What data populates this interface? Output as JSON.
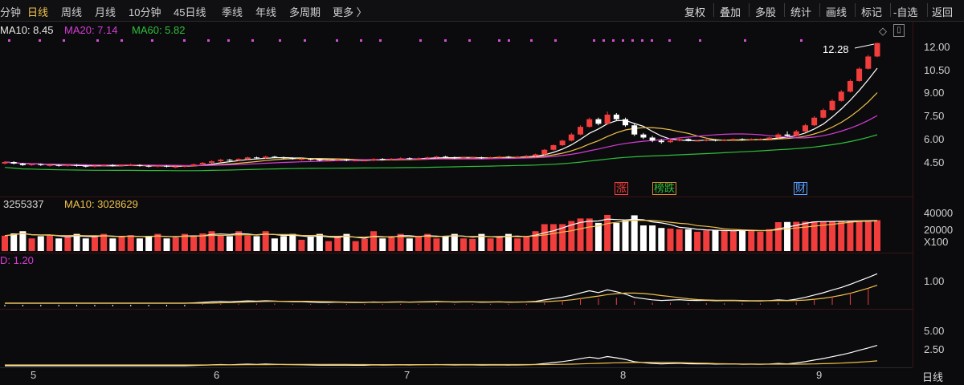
{
  "toolbar": {
    "periods": [
      "分钟",
      "日线",
      "周线",
      "月线",
      "10分钟",
      "45日线",
      "季线",
      "年线",
      "多周期",
      "更多 〉"
    ],
    "active_period": "日线",
    "tools": [
      "复权",
      "叠加",
      "多股",
      "统计",
      "画线",
      "标记",
      "-自选",
      "返回"
    ]
  },
  "ma_legend": {
    "ma10": "MA10: 8.45",
    "ma20": "MA20: 7.14",
    "ma60": "MA60: 5.82",
    "ma10_color": "#e8e8e8",
    "ma20_color": "#d63cd6",
    "ma60_color": "#2fbf3a"
  },
  "price_axis": [
    "12.00",
    "10.50",
    "9.00",
    "7.50",
    "6.00",
    "4.50"
  ],
  "last_price_label": "12.28",
  "event_tags": {
    "zhang": "涨",
    "bangdie": "榜跌",
    "cai": "财"
  },
  "volume_legend": {
    "vol": "3255337",
    "ma10": "MA10: 3028629"
  },
  "volume_axis": [
    "40000",
    "20000",
    "X100"
  ],
  "indicator_legend": "D: 1.20",
  "indicator_axis": [
    "1.00"
  ],
  "bottom_axis": [
    "5.00",
    "2.50"
  ],
  "x_axis": [
    "5",
    "6",
    "7",
    "8",
    "9"
  ],
  "corner_label": "日线",
  "colors": {
    "up": "#f23d3d",
    "down": "#ffffff",
    "accent": "#f0c14b"
  },
  "chart_data": {
    "type": "candlestick",
    "months": [
      "5",
      "6",
      "7",
      "8",
      "9"
    ],
    "price_axis": [
      4.5,
      6.0,
      7.5,
      9.0,
      10.5,
      12.0
    ],
    "last_price": 12.28,
    "candles": [
      [
        4.4,
        4.5,
        4.35,
        4.55
      ],
      [
        4.5,
        4.4,
        4.35,
        4.55
      ],
      [
        4.4,
        4.3,
        4.25,
        4.45
      ],
      [
        4.3,
        4.35,
        4.25,
        4.4
      ],
      [
        4.35,
        4.3,
        4.25,
        4.4
      ],
      [
        4.3,
        4.3,
        4.2,
        4.35
      ],
      [
        4.3,
        4.25,
        4.2,
        4.35
      ],
      [
        4.25,
        4.3,
        4.2,
        4.35
      ],
      [
        4.3,
        4.25,
        4.2,
        4.35
      ],
      [
        4.25,
        4.2,
        4.15,
        4.3
      ],
      [
        4.2,
        4.25,
        4.15,
        4.3
      ],
      [
        4.25,
        4.3,
        4.2,
        4.35
      ],
      [
        4.3,
        4.25,
        4.2,
        4.35
      ],
      [
        4.25,
        4.3,
        4.2,
        4.35
      ],
      [
        4.3,
        4.3,
        4.25,
        4.4
      ],
      [
        4.3,
        4.25,
        4.2,
        4.35
      ],
      [
        4.25,
        4.2,
        4.15,
        4.3
      ],
      [
        4.2,
        4.25,
        4.15,
        4.3
      ],
      [
        4.25,
        4.2,
        4.15,
        4.3
      ],
      [
        4.2,
        4.2,
        4.1,
        4.25
      ],
      [
        4.2,
        4.25,
        4.15,
        4.3
      ],
      [
        4.25,
        4.35,
        4.2,
        4.4
      ],
      [
        4.35,
        4.45,
        4.3,
        4.5
      ],
      [
        4.45,
        4.55,
        4.4,
        4.6
      ],
      [
        4.55,
        4.65,
        4.5,
        4.7
      ],
      [
        4.65,
        4.6,
        4.55,
        4.7
      ],
      [
        4.6,
        4.7,
        4.55,
        4.75
      ],
      [
        4.7,
        4.8,
        4.65,
        4.85
      ],
      [
        4.8,
        4.75,
        4.7,
        4.85
      ],
      [
        4.75,
        4.85,
        4.7,
        4.9
      ],
      [
        4.85,
        4.8,
        4.75,
        4.9
      ],
      [
        4.8,
        4.75,
        4.7,
        4.85
      ],
      [
        4.75,
        4.7,
        4.65,
        4.8
      ],
      [
        4.7,
        4.7,
        4.6,
        4.75
      ],
      [
        4.7,
        4.65,
        4.6,
        4.75
      ],
      [
        4.65,
        4.6,
        4.55,
        4.7
      ],
      [
        4.6,
        4.6,
        4.55,
        4.65
      ],
      [
        4.6,
        4.65,
        4.55,
        4.7
      ],
      [
        4.65,
        4.6,
        4.55,
        4.7
      ],
      [
        4.6,
        4.6,
        4.55,
        4.65
      ],
      [
        4.6,
        4.6,
        4.55,
        4.65
      ],
      [
        4.6,
        4.7,
        4.55,
        4.75
      ],
      [
        4.7,
        4.65,
        4.6,
        4.75
      ],
      [
        4.65,
        4.7,
        4.6,
        4.75
      ],
      [
        4.7,
        4.75,
        4.65,
        4.8
      ],
      [
        4.75,
        4.7,
        4.65,
        4.8
      ],
      [
        4.7,
        4.75,
        4.65,
        4.8
      ],
      [
        4.75,
        4.8,
        4.7,
        4.85
      ],
      [
        4.8,
        4.85,
        4.75,
        4.9
      ],
      [
        4.85,
        4.8,
        4.75,
        4.9
      ],
      [
        4.8,
        4.75,
        4.7,
        4.85
      ],
      [
        4.75,
        4.8,
        4.7,
        4.85
      ],
      [
        4.8,
        4.8,
        4.75,
        4.85
      ],
      [
        4.8,
        4.75,
        4.7,
        4.85
      ],
      [
        4.75,
        4.8,
        4.7,
        4.85
      ],
      [
        4.8,
        4.85,
        4.75,
        4.9
      ],
      [
        4.85,
        4.8,
        4.75,
        4.9
      ],
      [
        4.8,
        4.85,
        4.75,
        4.9
      ],
      [
        4.85,
        4.9,
        4.8,
        4.95
      ],
      [
        4.9,
        5.0,
        4.85,
        5.05
      ],
      [
        5.0,
        5.3,
        4.95,
        5.35
      ],
      [
        5.3,
        5.6,
        5.25,
        5.65
      ],
      [
        5.6,
        5.9,
        5.55,
        5.95
      ],
      [
        5.9,
        6.3,
        5.85,
        6.4
      ],
      [
        6.3,
        6.8,
        6.25,
        6.9
      ],
      [
        6.8,
        7.3,
        6.75,
        7.4
      ],
      [
        7.3,
        7.0,
        6.9,
        7.4
      ],
      [
        7.0,
        7.6,
        6.95,
        7.8
      ],
      [
        7.6,
        7.3,
        7.2,
        7.7
      ],
      [
        7.3,
        6.9,
        6.8,
        7.4
      ],
      [
        6.9,
        6.3,
        6.2,
        7.0
      ],
      [
        6.3,
        6.1,
        6.0,
        6.4
      ],
      [
        6.1,
        5.9,
        5.8,
        6.2
      ],
      [
        5.9,
        5.8,
        5.7,
        6.0
      ],
      [
        5.8,
        5.9,
        5.75,
        6.0
      ],
      [
        5.9,
        6.0,
        5.85,
        6.05
      ],
      [
        6.0,
        5.9,
        5.85,
        6.05
      ],
      [
        5.9,
        5.9,
        5.85,
        5.95
      ],
      [
        5.9,
        5.95,
        5.85,
        6.0
      ],
      [
        5.95,
        5.9,
        5.85,
        6.0
      ],
      [
        5.9,
        5.95,
        5.85,
        6.0
      ],
      [
        5.95,
        6.0,
        5.9,
        6.05
      ],
      [
        6.0,
        5.95,
        5.9,
        6.05
      ],
      [
        5.95,
        6.0,
        5.9,
        6.05
      ],
      [
        6.0,
        6.0,
        5.95,
        6.05
      ],
      [
        6.0,
        6.1,
        5.95,
        6.15
      ],
      [
        6.1,
        6.3,
        6.05,
        6.4
      ],
      [
        6.3,
        6.2,
        6.15,
        6.5
      ],
      [
        6.2,
        6.5,
        6.15,
        6.6
      ],
      [
        6.5,
        6.9,
        6.45,
        7.0
      ],
      [
        6.9,
        7.4,
        6.85,
        7.5
      ],
      [
        7.4,
        7.9,
        7.35,
        8.0
      ],
      [
        7.9,
        8.5,
        7.85,
        8.6
      ],
      [
        8.5,
        9.1,
        8.45,
        9.2
      ],
      [
        9.1,
        9.8,
        9.05,
        9.9
      ],
      [
        9.8,
        10.6,
        9.75,
        10.7
      ],
      [
        10.6,
        11.4,
        10.55,
        11.5
      ],
      [
        11.4,
        12.28,
        11.35,
        12.3
      ]
    ],
    "candle_format": [
      "open",
      "close",
      "low",
      "high"
    ]
  }
}
